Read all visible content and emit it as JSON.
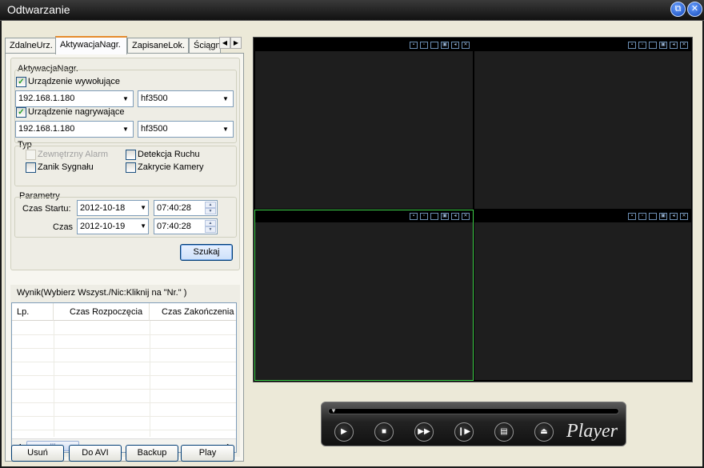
{
  "window": {
    "title": "Odtwarzanie"
  },
  "tabs": [
    {
      "label": "ZdalneUrz.",
      "active": false
    },
    {
      "label": "AktywacjaNagr.",
      "active": true
    },
    {
      "label": "ZapisaneLok.",
      "active": false
    },
    {
      "label": "Ściągnij",
      "active": false
    }
  ],
  "activation": {
    "group_label": "AktywacjaNagr.",
    "caller": {
      "label": "Urządzenie wywołujące",
      "checked": true,
      "ip": "192.168.1.180",
      "device": "hf3500"
    },
    "recorder": {
      "label": "Urządzenie nagrywające",
      "checked": true,
      "ip": "192.168.1.180",
      "device": "hf3500"
    },
    "type": {
      "label": "Typ",
      "external_alarm": "Zewnętrzny Alarm",
      "motion_detect": "Detekcja Ruchu",
      "signal_loss": "Zanik Sygnału",
      "camera_cover": "Zakrycie Kamery"
    },
    "params": {
      "label": "Parametry",
      "start_label": "Czas Startu:",
      "start_date": "2012-10-18",
      "start_time": "07:40:28",
      "end_label": "Czas",
      "end_date": "2012-10-19",
      "end_time": "07:40:28"
    },
    "search_label": "Szukaj"
  },
  "results": {
    "label": "Wynik(Wybierz Wszyst./Nic:Kliknij na \"Nr.\" )",
    "columns": [
      "Lp.",
      "Czas Rozpoczęcia",
      "Czas Zakończenia"
    ],
    "scroll_thumb": "III"
  },
  "bottom_buttons": {
    "delete": "Usuń",
    "to_avi": "Do AVI",
    "backup": "Backup",
    "play": "Play"
  },
  "player": {
    "brand": "Player"
  }
}
